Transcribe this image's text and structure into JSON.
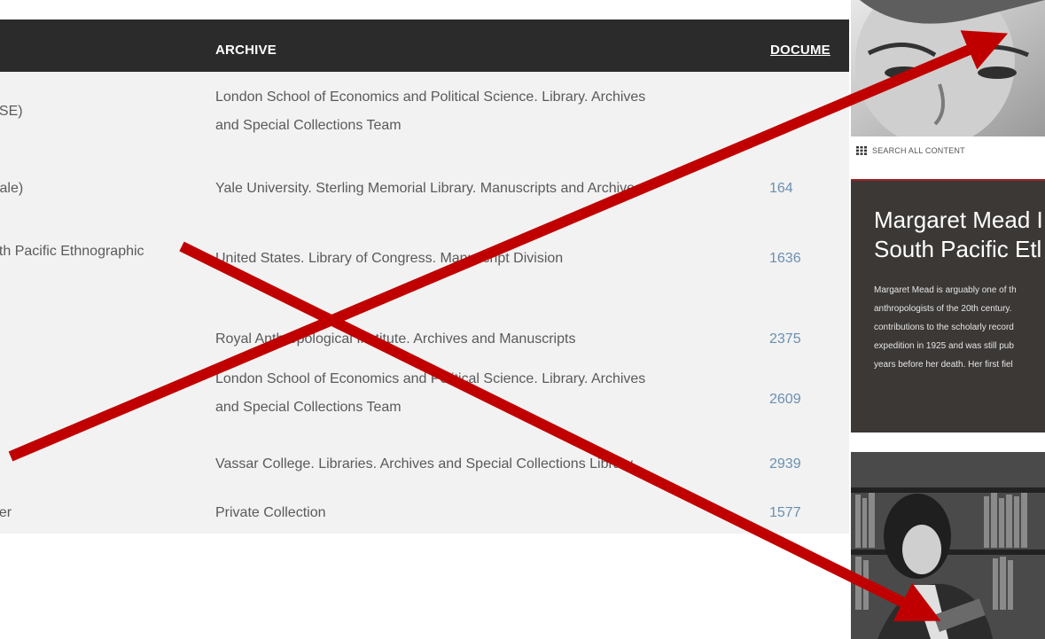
{
  "table": {
    "headers": {
      "archive": "ARCHIVE",
      "documents": "DOCUME"
    },
    "rows": [
      {
        "collection": "LSE)",
        "archive_lines": [
          "London School of Economics and Political Science. Library. Archives",
          "and Special Collections Team"
        ],
        "documents": ""
      },
      {
        "collection": "Yale)",
        "archive_lines": [
          "Yale University. Sterling Memorial Library. Manuscripts and Archives"
        ],
        "documents": "164"
      },
      {
        "collection": "uth Pacific Ethnographic",
        "archive_lines": [
          "United States. Library of Congress. Manuscript Division"
        ],
        "documents": "1636"
      },
      {
        "collection": "",
        "archive_lines": [
          "Royal Anthropological Institute. Archives and Manuscripts"
        ],
        "documents": "2375"
      },
      {
        "collection": "",
        "archive_lines": [
          "London School of Economics and Political Science. Library. Archives",
          "and Special Collections Team"
        ],
        "documents": "2609"
      },
      {
        "collection": "",
        "archive_lines": [
          "Vassar College. Libraries. Archives and Special Collections Library"
        ],
        "documents": "2939"
      },
      {
        "collection": "ner",
        "archive_lines": [
          "Private Collection"
        ],
        "documents": "1577"
      }
    ]
  },
  "sidebar": {
    "search_label": "SEARCH ALL CONTENT",
    "search_icon": "grid-icon",
    "feature_title_lines": [
      "Margaret Mead I",
      "South Pacific Etl"
    ],
    "feature_text_lines": [
      "Margaret Mead is arguably one of th",
      "anthropologists of the 20th century.",
      "contributions to the scholarly record",
      "expedition in 1925 and was still pub",
      "years before her death. Her first fiel"
    ],
    "feature_accent": "#a42226"
  },
  "overlay": {
    "color": "#c00000",
    "marks": [
      "red-cross",
      "red-arrow-up-right",
      "red-arrow-down-right"
    ]
  }
}
